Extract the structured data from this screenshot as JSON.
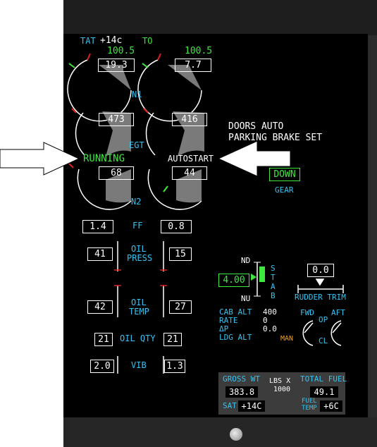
{
  "header": {
    "tat_label": "TAT",
    "tat_value": "+14c",
    "thrust_mode": "TO",
    "n1_limit_left": "100.5",
    "n1_limit_right": "100.5"
  },
  "n1": {
    "label": "N1",
    "left": "19.3",
    "right": "7.7"
  },
  "egt": {
    "label": "EGT",
    "left": "473",
    "right": "416"
  },
  "n2": {
    "label": "N2",
    "left": "68",
    "right": "44"
  },
  "engine_status": {
    "left": "RUNNING",
    "right": "AUTOSTART"
  },
  "messages": {
    "line1": "DOORS AUTO",
    "line2": "PARKING BRAKE SET"
  },
  "gear": {
    "state": "DOWN",
    "label": "GEAR"
  },
  "ff": {
    "label": "FF",
    "left": "1.4",
    "right": "0.8"
  },
  "oil_press": {
    "label1": "OIL",
    "label2": "PRESS",
    "left": "41",
    "right": "15"
  },
  "oil_temp": {
    "label1": "OIL",
    "label2": "TEMP",
    "left": "42",
    "right": "27"
  },
  "oil_qty": {
    "label": "OIL QTY",
    "left": "21",
    "right": "21"
  },
  "vib": {
    "label": "VIB",
    "left": "2.0",
    "right": "1.3"
  },
  "stab": {
    "nd": "ND",
    "nu": "NU",
    "value": "4.00",
    "label": [
      "S",
      "T",
      "A",
      "B"
    ]
  },
  "rudder_trim": {
    "value": "0.0",
    "label": "RUDDER TRIM"
  },
  "cabin": {
    "labels": [
      "CAB ALT",
      "RATE",
      "ΔP",
      "LDG ALT"
    ],
    "values": [
      "400",
      "0",
      "0.0",
      ""
    ],
    "mode": "MAN"
  },
  "outflow_valve": {
    "fwd": "FWD",
    "aft": "AFT",
    "op": "OP",
    "cl": "CL"
  },
  "bottom": {
    "gross_wt_label": "GROSS WT",
    "gross_wt": "383.8",
    "units": "LBS X",
    "units2": "1000",
    "total_fuel_label": "TOTAL FUEL",
    "total_fuel": "49.1",
    "sat_label": "SAT",
    "sat": "+14C",
    "fuel_temp_label1": "FUEL",
    "fuel_temp_label2": "TEMP",
    "fuel_temp": "+6C"
  },
  "colors": {
    "cyan": "#34c3f2",
    "green": "#3ee83e",
    "white": "#ffffff",
    "amber": "#f0a020",
    "red": "#e02020"
  }
}
